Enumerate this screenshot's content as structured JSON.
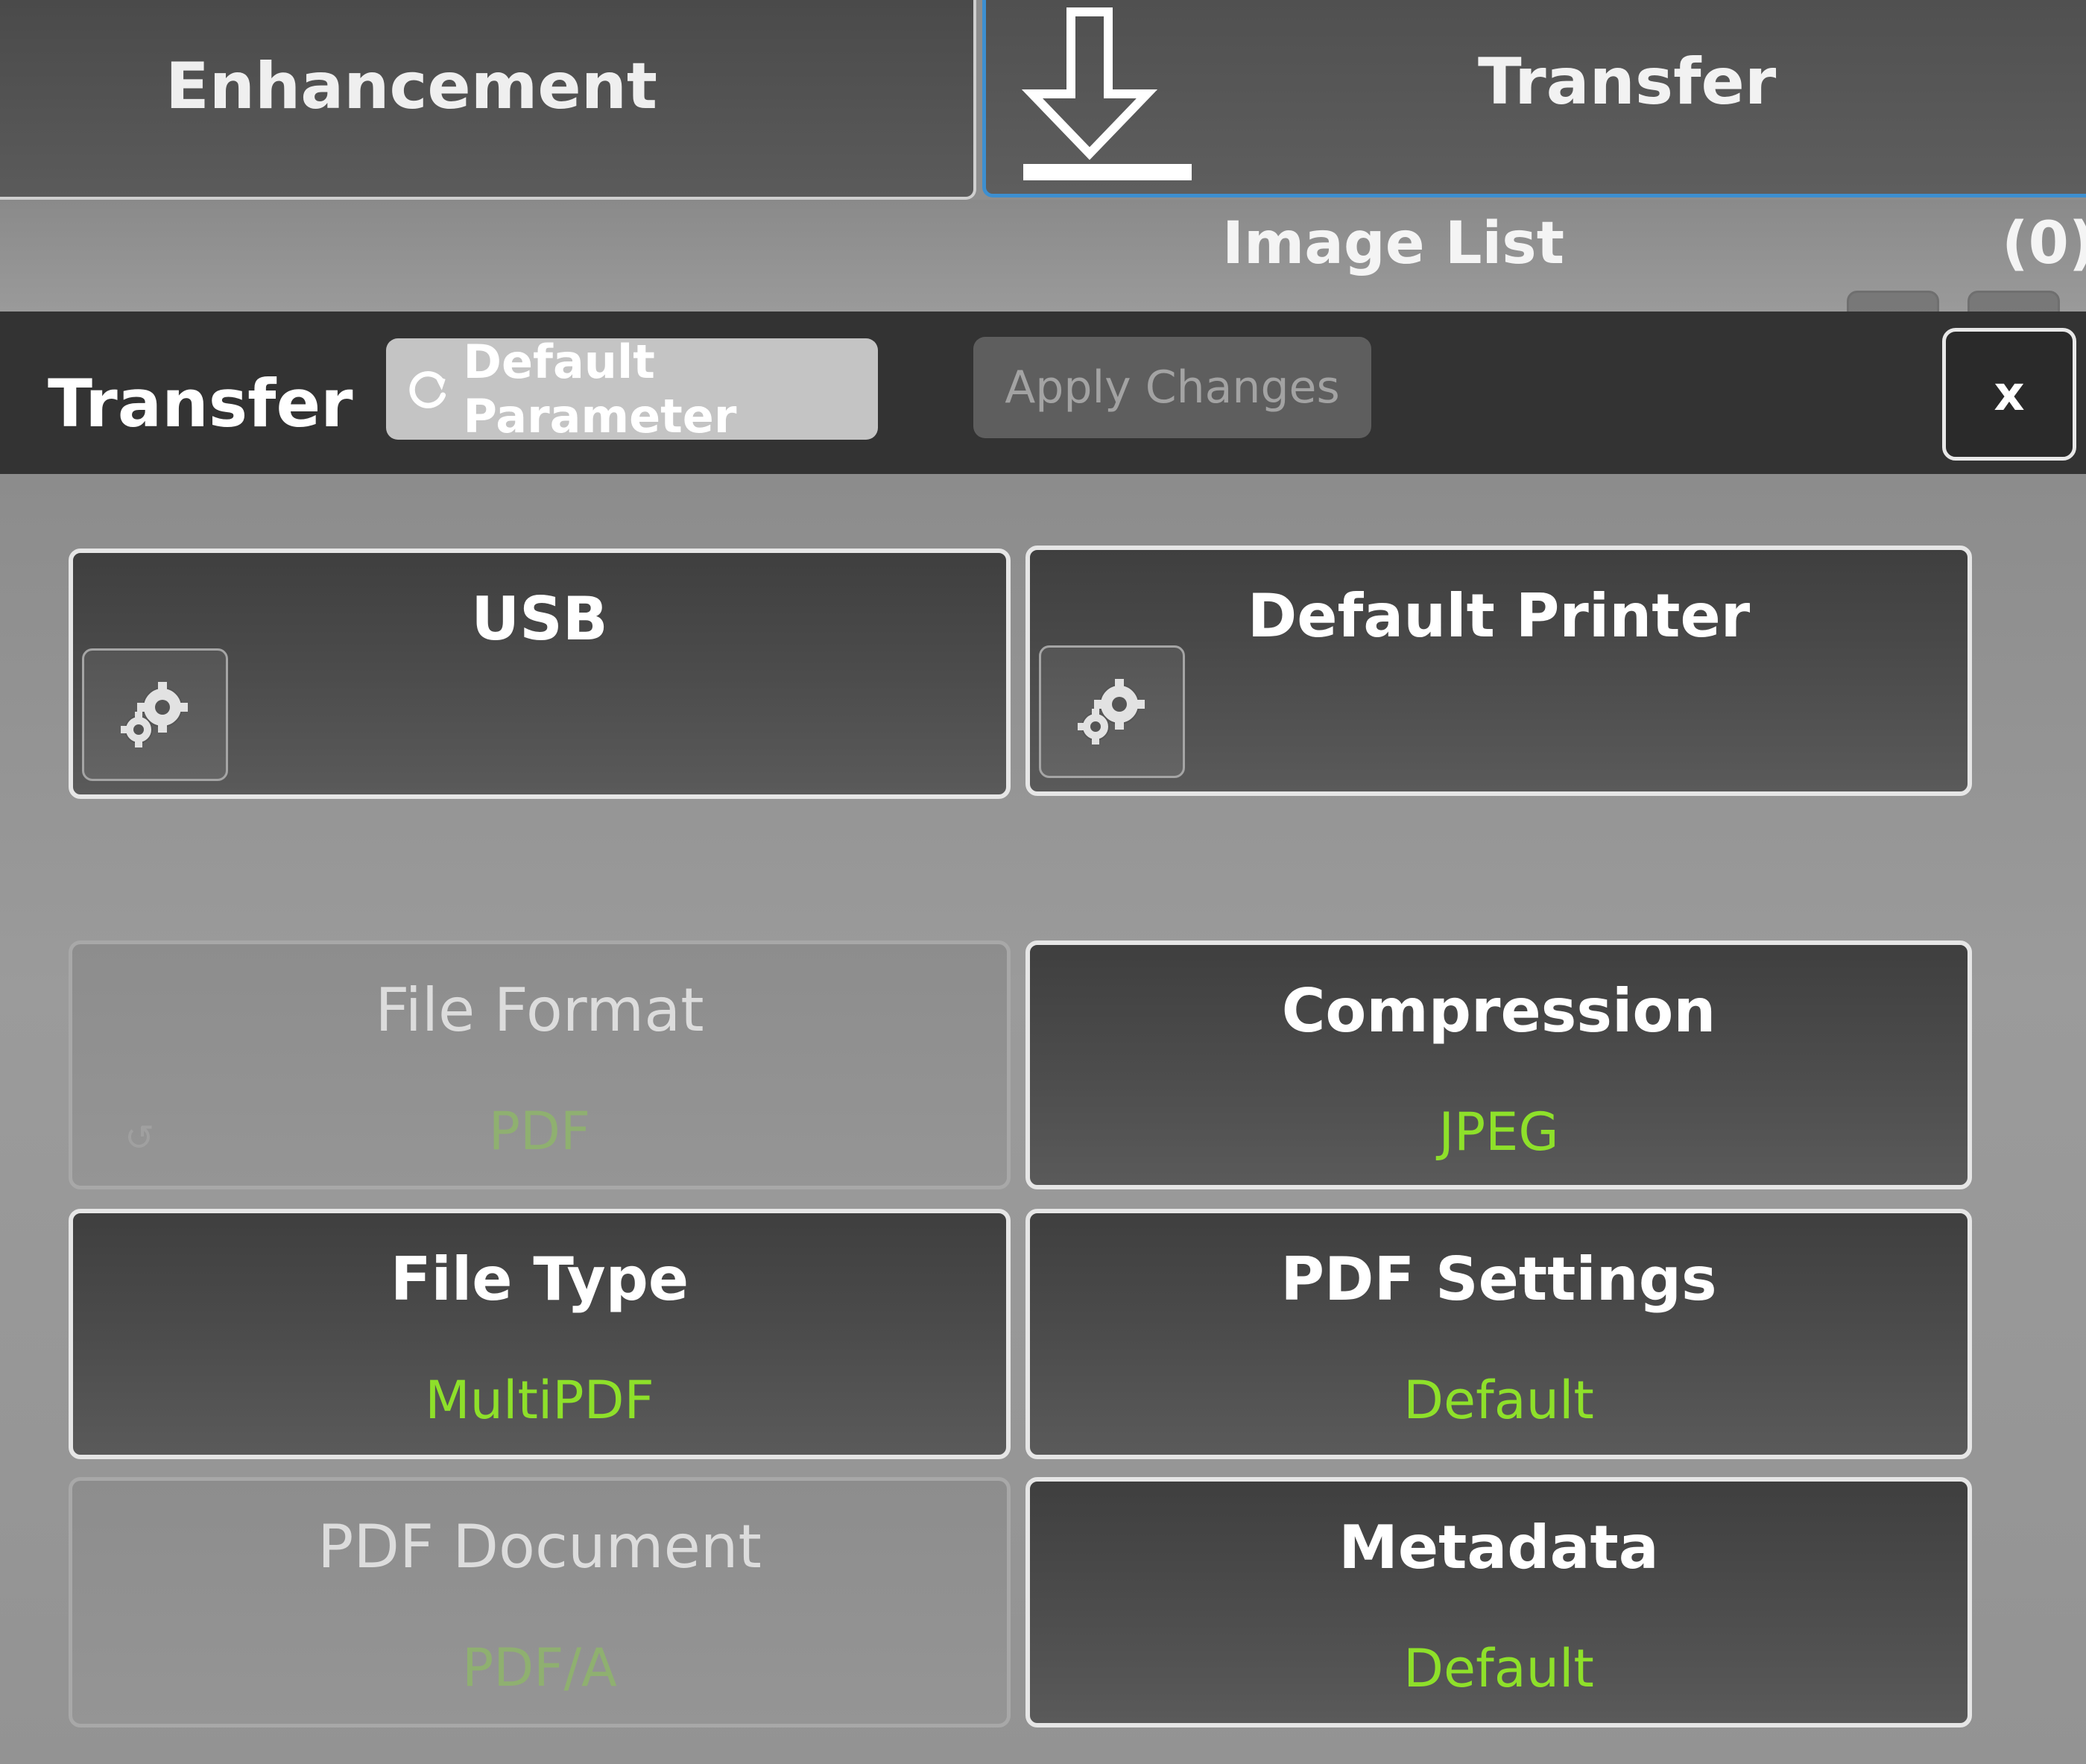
{
  "tabs": {
    "enhancement": {
      "label": "Enhancement"
    },
    "transfer": {
      "label": "Transfer"
    }
  },
  "image_list": {
    "title": "Image List",
    "count": "(0)"
  },
  "dialog": {
    "title": "Transfer",
    "default_parameter_label": "Default Parameter",
    "apply_changes_label": "Apply Changes",
    "close_label": "x"
  },
  "destinations": [
    {
      "label": "USB",
      "icon": "gear-icon"
    },
    {
      "label": "Default Printer",
      "icon": "gear-icon"
    }
  ],
  "settings": {
    "file_format": {
      "title": "File Format",
      "value": "PDF",
      "enabled": false
    },
    "compression": {
      "title": "Compression",
      "value": "JPEG",
      "enabled": true
    },
    "file_type": {
      "title": "File Type",
      "value": "MultiPDF",
      "enabled": true
    },
    "pdf_settings": {
      "title": "PDF Settings",
      "value": "Default",
      "enabled": true
    },
    "pdf_document": {
      "title": "PDF Document",
      "value": "PDF/A",
      "enabled": false
    },
    "metadata": {
      "title": "Metadata",
      "value": "Default",
      "enabled": true
    }
  },
  "colors": {
    "accent_blue": "#3d8fd0",
    "value_green": "#8ee02a",
    "header_dark": "#333333"
  }
}
